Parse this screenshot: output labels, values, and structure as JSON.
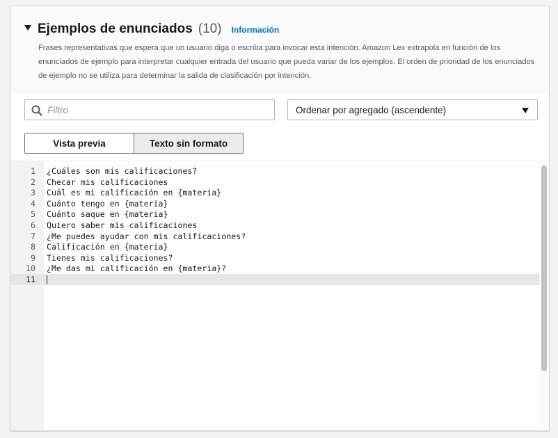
{
  "section": {
    "title": "Ejemplos de enunciados",
    "count": "(10)",
    "info_link": "Información",
    "description": "Frases representativas que espera que un usuario diga o escriba para invocar esta intención. Amazon Lex extrapola en función de los enunciados de ejemplo para interpretar cualquier entrada del usuario que pueda variar de los ejemplos. El orden de prioridad de los enunciados de ejemplo no se utiliza para determinar la salida de clasificación por intención."
  },
  "filter": {
    "placeholder": "Filtro",
    "icon": "search-icon"
  },
  "sort": {
    "selected": "Ordenar por agregado (ascendente)",
    "icon": "caret-down-icon"
  },
  "view_toggle": {
    "preview_label": "Vista previa",
    "raw_label": "Texto sin formato",
    "selected": "raw"
  },
  "editor": {
    "lines": [
      {
        "num": "1",
        "text": "¿Cuáles son mis calificaciones?"
      },
      {
        "num": "2",
        "text": "Checar mis calificaciones"
      },
      {
        "num": "3",
        "text": "Cuál es mi calificación en {materia}"
      },
      {
        "num": "4",
        "text": "Cuánto tengo en {materia}"
      },
      {
        "num": "5",
        "text": "Cuánto saque en {materia}"
      },
      {
        "num": "6",
        "text": "Quiero saber mis calificaciones"
      },
      {
        "num": "7",
        "text": "¿Me puedes ayudar con mis calificaciones?"
      },
      {
        "num": "8",
        "text": "Calificación en {materia}"
      },
      {
        "num": "9",
        "text": "Tienes mis calificaciones?"
      },
      {
        "num": "10",
        "text": "¿Me das mi calificación en {materia}?"
      },
      {
        "num": "11",
        "text": ""
      }
    ],
    "active_line": "11"
  }
}
